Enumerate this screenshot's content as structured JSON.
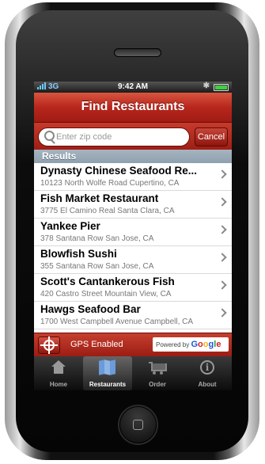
{
  "status_bar": {
    "carrier": "3G",
    "time": "9:42 AM"
  },
  "header": {
    "title": "Find Restaurants"
  },
  "search": {
    "placeholder": "Enter zip code",
    "cancel_label": "Cancel"
  },
  "results": {
    "header": "Results",
    "items": [
      {
        "name": "Dynasty Chinese Seafood Re...",
        "address": "10123 North Wolfe Road Cupertino, CA"
      },
      {
        "name": "Fish Market Restaurant",
        "address": "3775 El Camino Real Santa Clara, CA"
      },
      {
        "name": "Yankee Pier",
        "address": "378 Santana Row San Jose, CA"
      },
      {
        "name": "Blowfish Sushi",
        "address": "355 Santana Row San Jose, CA"
      },
      {
        "name": "Scott's Cantankerous Fish",
        "address": "420 Castro Street Mountain View, CA"
      },
      {
        "name": "Hawgs Seafood Bar",
        "address": "1700 West Campbell Avenue Campbell, CA"
      }
    ]
  },
  "gps": {
    "label": "GPS Enabled",
    "powered_by": "Powered by",
    "google": "Google"
  },
  "tabs": [
    {
      "label": "Home",
      "icon": "home-icon"
    },
    {
      "label": "Restaurants",
      "icon": "map-icon"
    },
    {
      "label": "Order",
      "icon": "cart-icon"
    },
    {
      "label": "About",
      "icon": "info-icon"
    }
  ],
  "colors": {
    "accent_red": "#b7261c",
    "results_header": "#8fa0ae",
    "tab_bar": "#1a1a1a"
  }
}
